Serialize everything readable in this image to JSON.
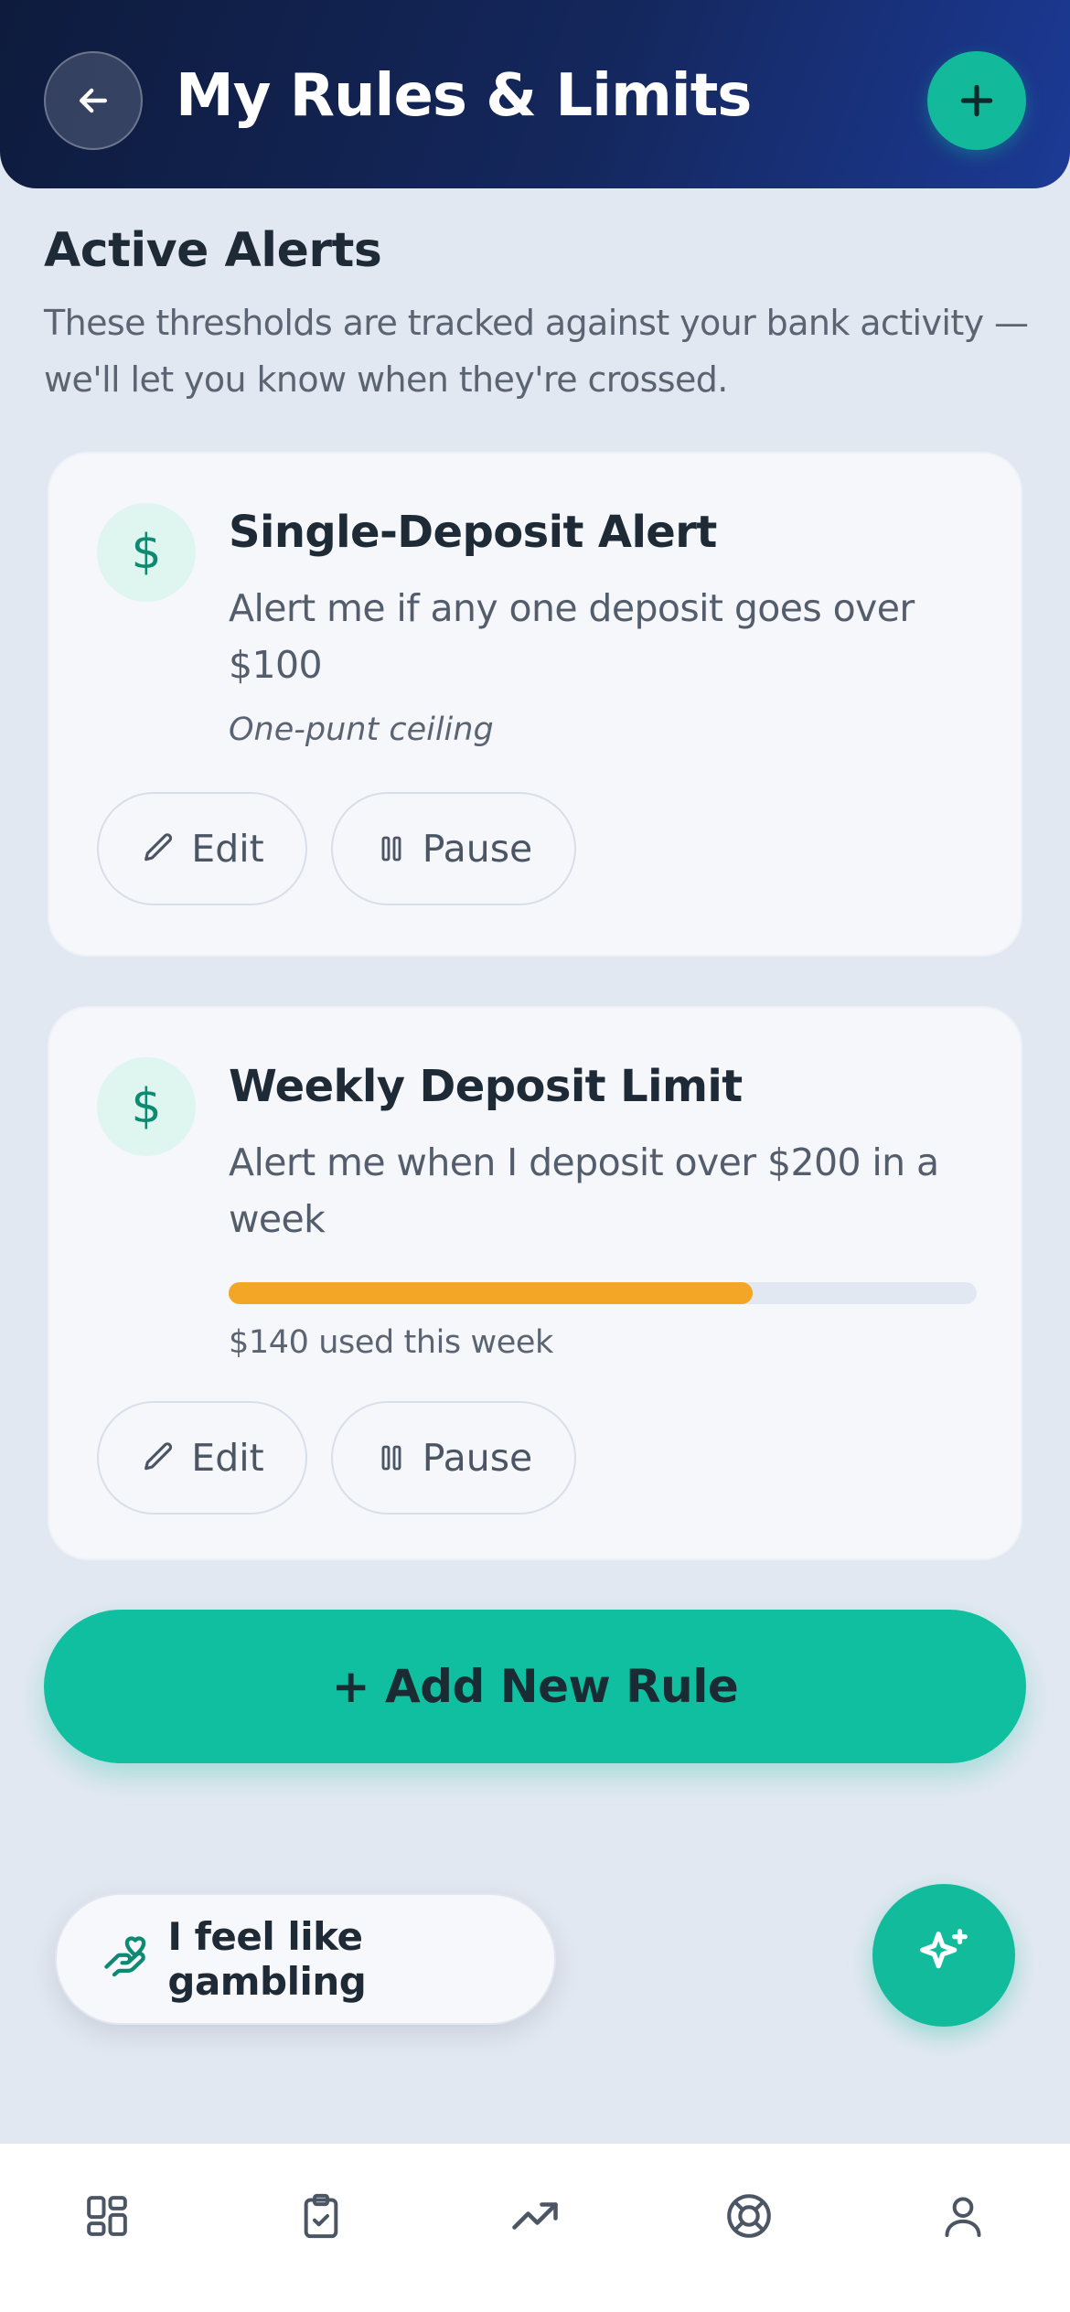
{
  "header": {
    "title": "My Rules & Limits",
    "back_icon": "arrow-left-icon",
    "add_icon": "plus-icon"
  },
  "section": {
    "title": "Active Alerts",
    "description": "These thresholds are tracked against your bank activity — we'll let you know when they're crossed."
  },
  "rules": [
    {
      "icon": "dollar-icon",
      "icon_glyph": "$",
      "title": "Single-Deposit Alert",
      "description": "Alert me if any one deposit goes over $100",
      "note": "One-punt ceiling",
      "edit_label": "Edit",
      "pause_label": "Pause"
    },
    {
      "icon": "dollar-icon",
      "icon_glyph": "$",
      "title": "Weekly Deposit Limit",
      "description": "Alert me when I deposit over $200 in a week",
      "progress_fraction": 0.7,
      "progress_label": "$140 used this week",
      "edit_label": "Edit",
      "pause_label": "Pause"
    }
  ],
  "add_rule_label": "+ Add New Rule",
  "gamble_button": {
    "label": "I feel like gambling",
    "icon": "hand-heart-icon"
  },
  "assistant_fab_icon": "sparkle-icon",
  "bottom_nav": [
    "dashboard-icon",
    "clipboard-check-icon",
    "trending-up-icon",
    "lifebuoy-icon",
    "user-icon"
  ],
  "colors": {
    "header_start": "#0e1b3d",
    "header_end": "#1c3a96",
    "accent_teal": "#0fbfa0",
    "progress_orange": "#f3a626",
    "background": "#e2e8f1"
  }
}
